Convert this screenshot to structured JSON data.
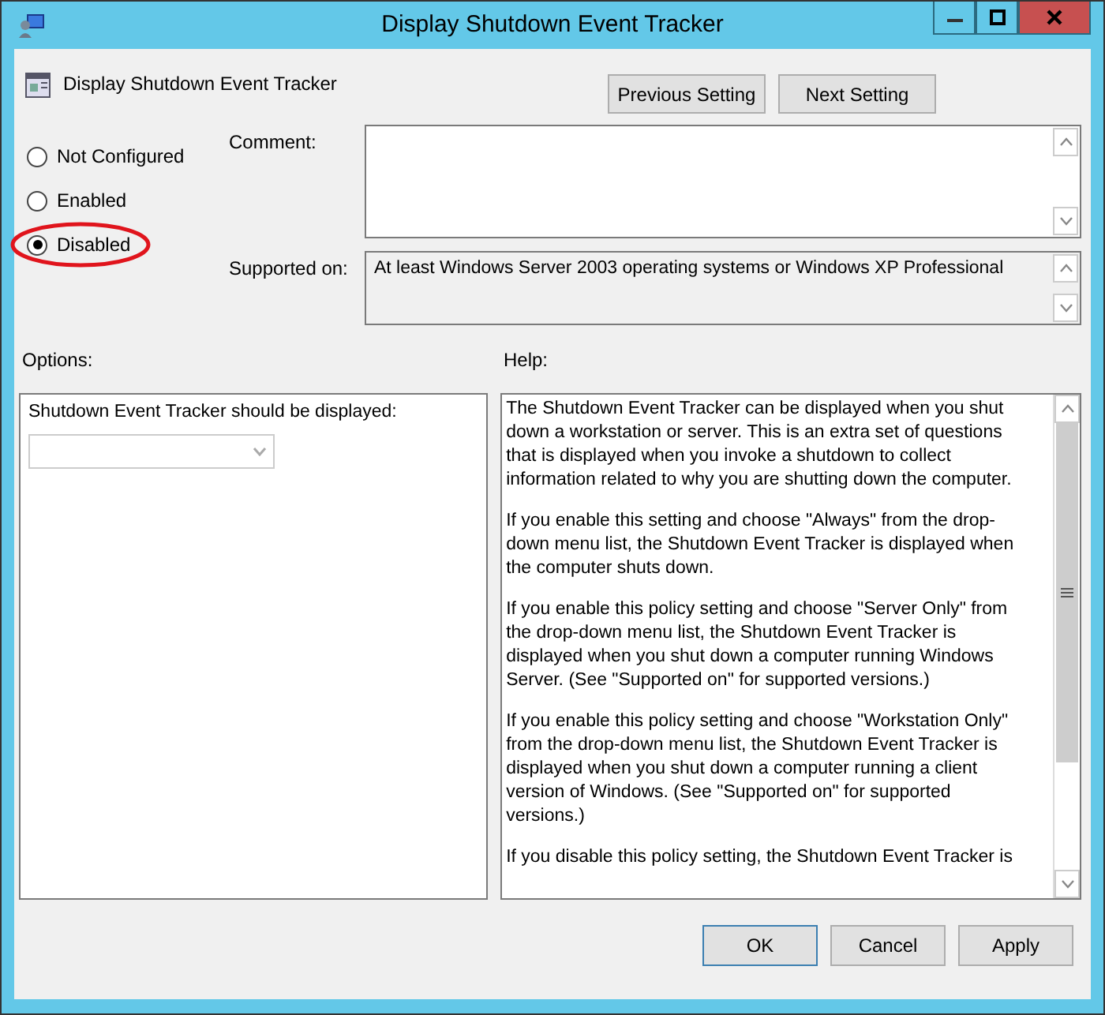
{
  "window": {
    "title": "Display Shutdown Event Tracker"
  },
  "header": {
    "title": "Display Shutdown Event Tracker"
  },
  "nav_buttons": [
    "Previous Setting",
    "Next Setting"
  ],
  "states": [
    {
      "label": "Not Configured",
      "selected": false,
      "circled": false
    },
    {
      "label": "Enabled",
      "selected": false,
      "circled": false
    },
    {
      "label": "Disabled",
      "selected": true,
      "circled": true
    }
  ],
  "comment": {
    "label": "Comment:"
  },
  "supported_on": {
    "label": "Supported on:",
    "value": "At least Windows Server 2003 operating systems or Windows XP Professional"
  },
  "options": {
    "label": "Options:",
    "field_label": "Shutdown Event Tracker should be displayed:",
    "dropdown_disabled": true
  },
  "help": {
    "label": "Help:",
    "paragraphs": [
      [
        "The Shutdown Event Tracker can be displayed when you shut",
        "down a workstation or server.  This is an extra set of questions",
        "that is displayed when you invoke a shutdown to collect",
        "information related to why you are shutting down the computer."
      ],
      [
        "If you enable this setting and choose \"Always\" from the drop-",
        "down menu list, the Shutdown Event Tracker is displayed when",
        "the computer shuts down."
      ],
      [
        "If you enable this policy setting and choose \"Server Only\" from",
        "the drop-down menu list, the Shutdown Event Tracker is",
        "displayed when you shut down a computer running Windows",
        "Server. (See \"Supported on\" for supported versions.)"
      ],
      [
        "If you enable this policy setting and choose \"Workstation Only\"",
        "from the drop-down menu list, the Shutdown Event Tracker is",
        "displayed when you shut down a computer running a client",
        "version of Windows. (See \"Supported on\" for supported",
        "versions.)"
      ],
      [
        "If you disable this policy setting, the Shutdown Event Tracker is"
      ]
    ]
  },
  "buttons": [
    {
      "label": "OK",
      "default": true
    },
    {
      "label": "Cancel",
      "default": false
    },
    {
      "label": "Apply",
      "default": false
    }
  ]
}
